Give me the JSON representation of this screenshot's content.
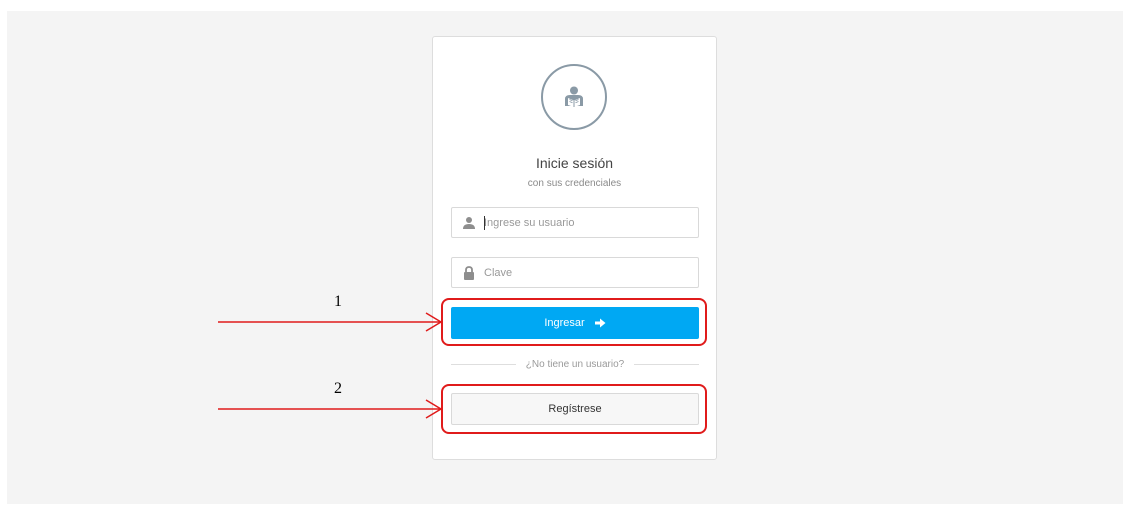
{
  "login": {
    "title": "Inicie sesión",
    "subtitle": "con sus credenciales",
    "username": {
      "placeholder": "Ingrese su usuario",
      "value": "",
      "icon": "user-icon"
    },
    "password": {
      "placeholder": "Clave",
      "value": "",
      "icon": "lock-icon"
    },
    "submit": {
      "label": "Ingresar",
      "icon": "arrow-right-icon"
    },
    "divider_text": "¿No tiene un usuario?",
    "register": {
      "label": "Regístrese"
    },
    "avatar_icon": "reader-icon"
  },
  "annotations": {
    "label_1": "1",
    "label_2": "2",
    "color": "#e01b1b"
  },
  "colors": {
    "primary": "#00a8f3",
    "background": "#f4f4f4",
    "icon_gray": "#8a9aa6"
  }
}
